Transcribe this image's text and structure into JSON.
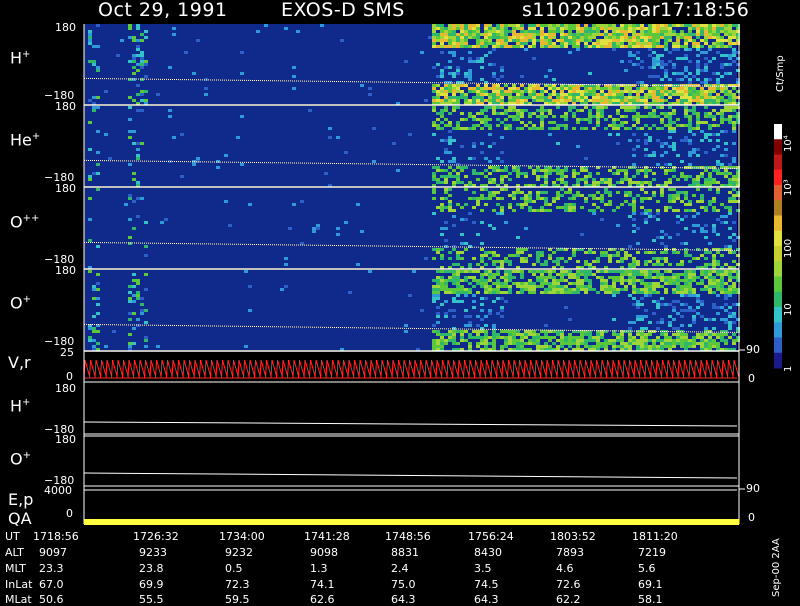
{
  "header": {
    "date": "Oct 29, 1991",
    "instrument": "EXOS-D SMS",
    "file": "s1102906.par",
    "time": "17:18:56"
  },
  "colors": {
    "background": "#000000",
    "spectrogram_bg": "#102a8c",
    "line_red": "#ff2a2a",
    "qa_bar": "#ffff40"
  },
  "chart_data": [
    {
      "type": "heatmap",
      "panels": [
        {
          "species": "H",
          "charge": "+",
          "ylim": [
            -180,
            180
          ],
          "tick_top": "180",
          "tick_bottom": "−180"
        },
        {
          "species": "He",
          "charge": "+",
          "ylim": [
            -180,
            180
          ],
          "tick_top": "180",
          "tick_bottom": "−180"
        },
        {
          "species": "O",
          "charge": "++",
          "ylim": [
            -180,
            180
          ],
          "tick_top": "180",
          "tick_bottom": "−180"
        },
        {
          "species": "O",
          "charge": "+",
          "ylim": [
            -180,
            180
          ],
          "tick_top": "180",
          "tick_bottom": "−180"
        }
      ],
      "colorbar": {
        "unit": "Ct/Smp",
        "labels": [
          "1",
          "10",
          "100",
          "10³",
          "10⁴"
        ],
        "scale": "log"
      }
    },
    {
      "type": "line",
      "ylabel": "V,r",
      "left_ticks": [
        "25",
        "0"
      ],
      "right_ticks": [
        "90",
        "0"
      ]
    },
    {
      "type": "line",
      "panels": [
        {
          "species": "H",
          "charge": "+",
          "tick_top": "180",
          "tick_bottom": "−180"
        },
        {
          "species": "O",
          "charge": "+",
          "tick_top": "180",
          "tick_bottom": "−180"
        }
      ]
    },
    {
      "type": "line",
      "ylabel_top": "E,p",
      "ylabel_bottom": "QA",
      "left_ticks": [
        "4000",
        "0"
      ],
      "right_ticks": [
        "90",
        "0"
      ]
    },
    {
      "type": "table",
      "rows": [
        {
          "label": "UT",
          "values": [
            "1718:56",
            "1726:32",
            "1734:00",
            "1741:28",
            "1748:56",
            "1756:24",
            "1803:52",
            "1811:20"
          ]
        },
        {
          "label": "ALT",
          "values": [
            "9097",
            "9233",
            "9232",
            "9098",
            "8831",
            "8430",
            "7893",
            "7219"
          ]
        },
        {
          "label": "MLT",
          "values": [
            "23.3",
            "23.8",
            "0.5",
            "1.3",
            "2.4",
            "3.5",
            "4.6",
            "5.6"
          ]
        },
        {
          "label": "InLat",
          "values": [
            "67.0",
            "69.9",
            "72.3",
            "74.1",
            "75.0",
            "74.5",
            "72.6",
            "69.1"
          ]
        },
        {
          "label": "MLat",
          "values": [
            "50.6",
            "55.5",
            "59.5",
            "62.6",
            "64.3",
            "64.3",
            "62.2",
            "58.1"
          ]
        }
      ]
    }
  ],
  "footer": {
    "stamp": "Sep-00  2AA"
  }
}
